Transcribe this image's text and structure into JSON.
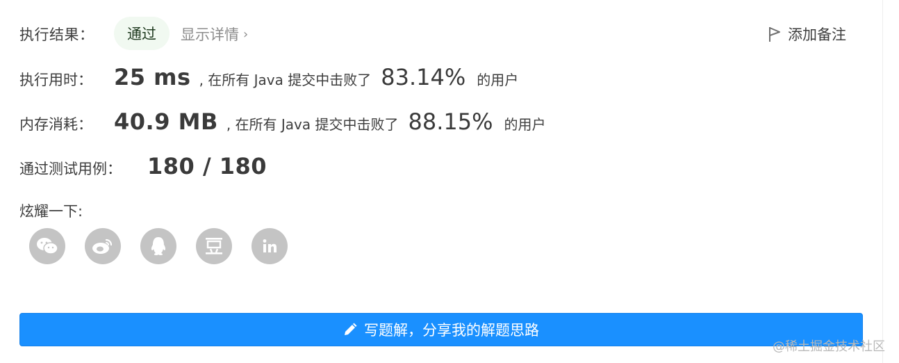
{
  "result": {
    "label": "执行结果：",
    "status": "通过",
    "details_link": "显示详情",
    "add_note": "添加备注"
  },
  "runtime": {
    "label": "执行用时：",
    "value": "25 ms",
    "middle_text": ", 在所有 Java 提交中击败了",
    "percent": "83.14%",
    "tail": "的用户"
  },
  "memory": {
    "label": "内存消耗：",
    "value": "40.9 MB",
    "middle_text": ", 在所有 Java 提交中击败了",
    "percent": "88.15%",
    "tail": "的用户"
  },
  "tests": {
    "label": "通过测试用例：",
    "value": "180 / 180"
  },
  "share": {
    "label": "炫耀一下:",
    "icons": [
      "wechat-icon",
      "weibo-icon",
      "qq-icon",
      "douban-icon",
      "linkedin-icon"
    ]
  },
  "write_solution_button": "写题解，分享我的解题思路",
  "watermark": "@稀土掘金技术社区",
  "colors": {
    "primary": "#1a90ff",
    "status_bg": "#f1f9f1",
    "icon_gray": "#c4c4c4"
  }
}
